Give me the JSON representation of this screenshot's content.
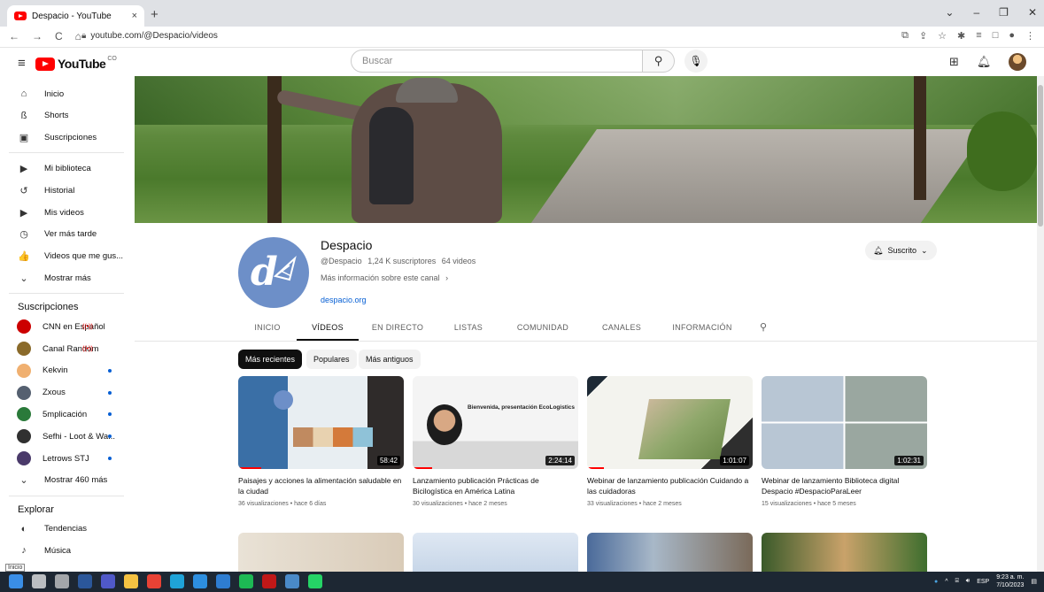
{
  "browser": {
    "tab_title": "Despacio - YouTube",
    "tab_close": "×",
    "new_tab": "+",
    "url": "youtube.com/@Despacio/videos",
    "window_controls": [
      "⌄",
      "–",
      "❐",
      "✕"
    ]
  },
  "header": {
    "logo_text": "YouTube",
    "logo_country": "CO",
    "search_placeholder": "Buscar"
  },
  "sidebar": {
    "main": [
      {
        "label": "Inicio",
        "icon": "home-icon",
        "glyph": "⌂"
      },
      {
        "label": "Shorts",
        "icon": "shorts-icon",
        "glyph": "ß"
      },
      {
        "label": "Suscripciones",
        "icon": "subscriptions-icon",
        "glyph": "▣"
      }
    ],
    "library": [
      {
        "label": "Mi biblioteca",
        "icon": "library-icon",
        "glyph": "▶"
      },
      {
        "label": "Historial",
        "icon": "history-icon",
        "glyph": "↺"
      },
      {
        "label": "Mis videos",
        "icon": "my-videos-icon",
        "glyph": "▶"
      },
      {
        "label": "Ver más tarde",
        "icon": "watch-later-icon",
        "glyph": "◷"
      },
      {
        "label": "Videos que me gus...",
        "icon": "like-icon",
        "glyph": "👍"
      },
      {
        "label": "Mostrar más",
        "icon": "chevron-down-icon",
        "glyph": "⌄"
      }
    ],
    "subscriptions_heading": "Suscripciones",
    "subscriptions": [
      {
        "label": "CNN en Español",
        "color": "#cc0000",
        "live": "((•))"
      },
      {
        "label": "Canal Random",
        "color": "#8a6a2a",
        "live": "((•))"
      },
      {
        "label": "Kekvin",
        "color": "#f0b070",
        "dot": true
      },
      {
        "label": "Zxous",
        "color": "#556070",
        "dot": true
      },
      {
        "label": "5mplicación",
        "color": "#2a7a3a",
        "dot": true
      },
      {
        "label": "Sefhi - Loot & Wa...",
        "color": "#303030",
        "dot": true
      },
      {
        "label": "Letrows STJ",
        "color": "#4a3a6a",
        "dot": true
      },
      {
        "label": "Mostrar 460 más",
        "color": "",
        "chevron": true
      }
    ],
    "explore_heading": "Explorar",
    "explore": [
      {
        "label": "Tendencias",
        "icon": "trending-icon",
        "glyph": "◐"
      },
      {
        "label": "Música",
        "icon": "music-icon",
        "glyph": "♪"
      }
    ]
  },
  "channel": {
    "name": "Despacio",
    "handle": "@Despacio",
    "subscribers": "1,24 K suscriptores",
    "videos_count": "64 videos",
    "more_info": "Más información sobre este canal",
    "link": "despacio.org",
    "subscribe_label": "Suscrito",
    "logo_letter": "d"
  },
  "tabs": [
    "INICIO",
    "VÍDEOS",
    "EN DIRECTO",
    "LISTAS",
    "COMUNIDAD",
    "CANALES",
    "INFORMACIÓN"
  ],
  "active_tab": "VÍDEOS",
  "chips": [
    "Más recientes",
    "Populares",
    "Más antiguos"
  ],
  "active_chip": "Más recientes",
  "videos": [
    {
      "title": "Paisajes y acciones la alimentación saludable en la ciudad",
      "meta": "36 visualizaciones • hace 6 días",
      "duration": "58:42"
    },
    {
      "title": "Lanzamiento publicación Prácticas de Bicilogística en América Latina",
      "meta": "30 visualizaciones • hace 2 meses",
      "duration": "2:24:14",
      "thumb_text": "Bienvenida, presentación EcoLogistics"
    },
    {
      "title": "Webinar de lanzamiento publicación Cuidando a las cuidadoras",
      "meta": "33 visualizaciones • hace 2 meses",
      "duration": "1:01:07"
    },
    {
      "title": "Webinar de lanzamiento Biblioteca digital Despacio #DespacioParaLeer",
      "meta": "15 visualizaciones • hace 5 meses",
      "duration": "1:02:31"
    }
  ],
  "taskbar": {
    "tooltip": "Inicio",
    "lang": "ESP",
    "time": "9:23 a. m.",
    "date": "7/10/2023"
  }
}
